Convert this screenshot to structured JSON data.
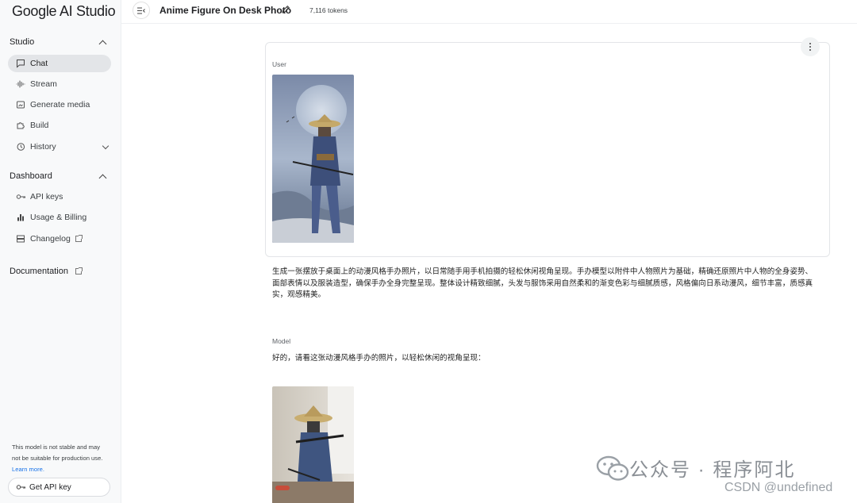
{
  "sidebar": {
    "brand": "Google AI Studio",
    "studio": {
      "heading": "Studio",
      "items": [
        {
          "label": "Chat",
          "icon": "chat-icon"
        },
        {
          "label": "Stream",
          "icon": "waveform-icon"
        },
        {
          "label": "Generate media",
          "icon": "media-icon"
        },
        {
          "label": "Build",
          "icon": "puzzle-icon"
        },
        {
          "label": "History",
          "icon": "history-icon"
        }
      ]
    },
    "dashboard": {
      "heading": "Dashboard",
      "items": [
        {
          "label": "API keys",
          "icon": "key-icon"
        },
        {
          "label": "Usage & Billing",
          "icon": "bar-chart-icon"
        },
        {
          "label": "Changelog",
          "icon": "list-icon"
        }
      ]
    },
    "documentation": "Documentation",
    "notice": {
      "text": "This model is not stable and may not be suitable for production use.",
      "link": "Learn more."
    },
    "get_api_key": "Get API key"
  },
  "header": {
    "title": "Anime Figure On Desk Photo",
    "tokens": "7,116 tokens"
  },
  "conversation": {
    "user_role": "User",
    "prompt": "生成一张摆放于桌面上的动漫风格手办照片，以日常随手用手机拍摄的轻松休闲视角呈现。手办模型以附件中人物照片为基础，精确还原照片中人物的全身姿势、面部表情以及服装造型，确保手办全身完整呈现。整体设计精致细腻，头发与服饰采用自然柔和的渐变色彩与细腻质感，风格偏向日系动漫风，细节丰富，质感真实，观感精美。",
    "model_role": "Model",
    "reply": "好的，请看这张动漫风格手办的照片，以轻松休闲的视角呈现："
  },
  "watermark": {
    "wechat": "公众号 · 程序阿北",
    "csdn": "CSDN @undefined"
  },
  "colors": {
    "sidebar_bg": "#f8f9fa",
    "active_bg": "#e3e5e8",
    "link": "#1a73e8"
  }
}
